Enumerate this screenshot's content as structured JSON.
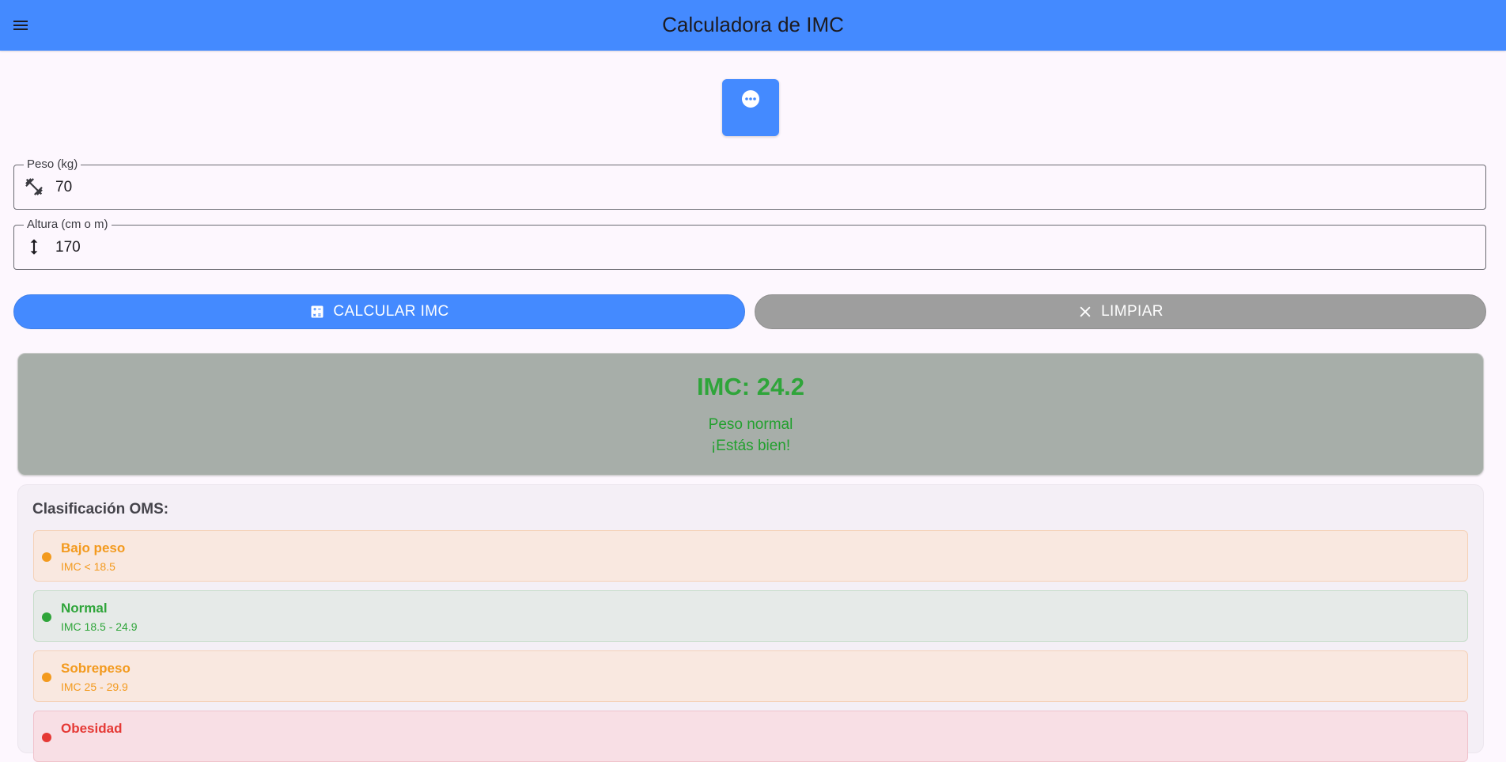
{
  "appbar": {
    "title": "Calculadora de IMC",
    "menu_icon": "menu-icon"
  },
  "logo": {
    "icon": "more-horiz-circle-icon"
  },
  "form": {
    "weight": {
      "label": "Peso (kg)",
      "value": "70",
      "icon": "fitness-icon"
    },
    "height": {
      "label": "Altura (cm o m)",
      "value": "170",
      "icon": "height-icon"
    }
  },
  "actions": {
    "calculate": {
      "label": "CALCULAR IMC",
      "icon": "calculate-icon"
    },
    "clear": {
      "label": "LIMPIAR",
      "icon": "close-icon"
    }
  },
  "result": {
    "imc": "IMC: 24.2",
    "category": "Peso normal",
    "message": "¡Estás bien!"
  },
  "oms": {
    "title": "Clasificación OMS:",
    "items": [
      {
        "name": "Bajo peso",
        "range": "IMC < 18.5",
        "color": "#f39a1e",
        "bg": "#f9e8e0",
        "border": "#f5d2b8"
      },
      {
        "name": "Normal",
        "range": "IMC 18.5 - 24.9",
        "color": "#2fa53a",
        "bg": "#e6eae8",
        "border": "#c6dcc9"
      },
      {
        "name": "Sobrepeso",
        "range": "IMC 25 - 29.9",
        "color": "#f39a1e",
        "bg": "#f9e8e0",
        "border": "#f5d2b8"
      },
      {
        "name": "Obesidad",
        "range": "",
        "color": "#e53935",
        "bg": "#f8dfe5",
        "border": "#f0c3cc"
      }
    ]
  },
  "colors": {
    "primary": "#448aff",
    "neutral": "#9e9e9e",
    "success": "#2fa53a"
  }
}
